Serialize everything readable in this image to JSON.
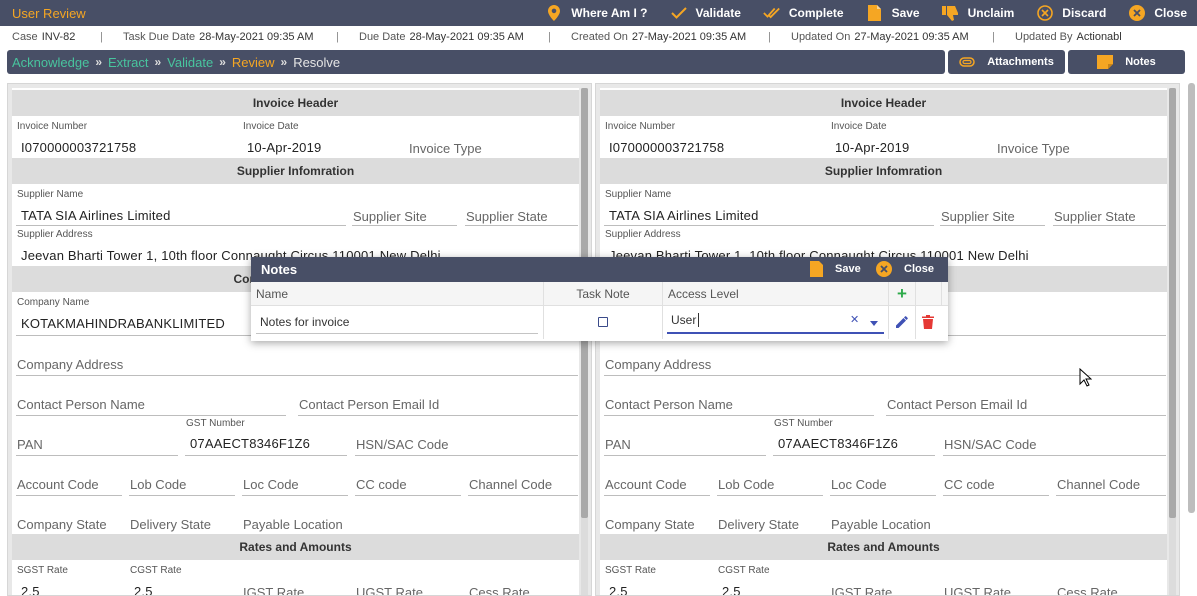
{
  "app": {
    "title": "User Review"
  },
  "toolbar": {
    "actions": [
      {
        "label": "Where Am I ?",
        "icon": "location-pin-icon"
      },
      {
        "label": "Validate",
        "icon": "check-icon"
      },
      {
        "label": "Complete",
        "icon": "double-check-icon"
      },
      {
        "label": "Save",
        "icon": "document-icon"
      },
      {
        "label": "Unclaim",
        "icon": "thumbs-down-icon"
      },
      {
        "label": "Discard",
        "icon": "circle-x-icon"
      },
      {
        "label": "Close",
        "icon": "close-icon"
      }
    ]
  },
  "info": {
    "case_label": "Case",
    "case_value": "INV-82",
    "task_due_label": "Task Due Date",
    "task_due_value": "28-May-2021 09:35 AM",
    "due_label": "Due Date",
    "due_value": "28-May-2021 09:35 AM",
    "created_label": "Created On",
    "created_value": "27-May-2021 09:35 AM",
    "updated_label": "Updated On",
    "updated_value": "27-May-2021 09:35 AM",
    "updated_by_label": "Updated By",
    "updated_by_value": "Actionabl",
    "separator": "|"
  },
  "workflow": {
    "steps": [
      "Acknowledge",
      "Extract",
      "Validate",
      "Review",
      "Resolve"
    ],
    "chevron": "»"
  },
  "side_buttons": {
    "attachments": "Attachments",
    "notes": "Notes"
  },
  "form": {
    "invoice_header": "Invoice Header",
    "invoice_number_label": "Invoice Number",
    "invoice_number": "I070000003721758",
    "invoice_date_label": "Invoice Date",
    "invoice_date": "10-Apr-2019",
    "invoice_type": "Invoice Type",
    "supplier_header": "Supplier Infomration",
    "supplier_name_label": "Supplier Name",
    "supplier_name": "TATA SIA Airlines Limited",
    "supplier_site": "Supplier Site",
    "supplier_state": "Supplier State",
    "supplier_address_label": "Supplier Address",
    "supplier_address": "Jeevan Bharti Tower 1, 10th floor Connaught Circus 110001 New Delhi",
    "company_header": "Company Information",
    "company_name_label": "Company Name",
    "company_name": "KOTAKMAHINDRABANKLIMITED",
    "company_address": "Company Address",
    "contact_person_name": "Contact Person Name",
    "contact_person_email": "Contact Person Email Id",
    "pan": "PAN",
    "gst_label": "GST Number",
    "gst_value": "07AAECT8346F1Z6",
    "hsn": "HSN/SAC Code",
    "account_code": "Account Code",
    "lob_code": "Lob Code",
    "loc_code": "Loc Code",
    "cc_code": "CC code",
    "channel_code": "Channel Code",
    "company_state": "Company State",
    "delivery_state": "Delivery State",
    "payable_location": "Payable Location",
    "rates_header": "Rates and Amounts",
    "sgst_label": "SGST Rate",
    "sgst_value": "2.5",
    "cgst_label": "CGST Rate",
    "cgst_value": "2.5",
    "igst": "IGST Rate",
    "ugst": "UGST Rate",
    "cess": "Cess Rate"
  },
  "notes_dialog": {
    "title": "Notes",
    "save_label": "Save",
    "close_label": "Close",
    "columns": {
      "name": "Name",
      "task_note": "Task Note",
      "access_level": "Access Level"
    },
    "row": {
      "name": "Notes for invoice",
      "task_note_checked": false,
      "access_level": "User"
    },
    "add_symbol": "+",
    "clear_symbol": "✕"
  },
  "colors": {
    "bar": "#484f66",
    "accent_orange": "#f5a623",
    "step_done": "#48c49e",
    "add_green": "#2eaa4a",
    "delete_red": "#e53935",
    "edit_blue": "#3f51b5"
  }
}
